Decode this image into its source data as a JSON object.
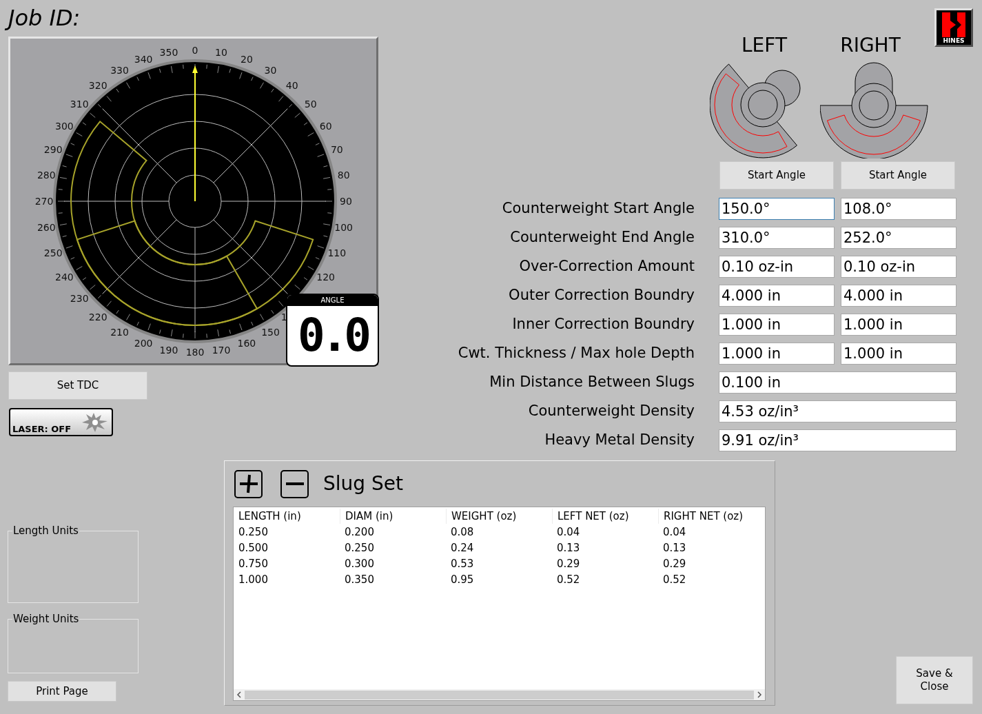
{
  "header": {
    "title": "Job ID:"
  },
  "logo": {
    "text": "HINES"
  },
  "dial": {
    "tick_labels": [
      "350",
      "0",
      "10",
      "340",
      "20",
      "330",
      "30",
      "320",
      "40",
      "310",
      "50",
      "300",
      "60",
      "290",
      "70",
      "280",
      "80",
      "270",
      "90",
      "260",
      "100",
      "250",
      "110",
      "240",
      "120",
      "230",
      "220",
      "1",
      "210",
      "150",
      "200",
      "160",
      "190",
      "180",
      "170"
    ],
    "angle_display": {
      "label": "ANGLE",
      "value": "0.0"
    }
  },
  "left_buttons": {
    "set_tdc": "Set TDC",
    "laser": "LASER: OFF"
  },
  "sides": [
    {
      "heading": "LEFT",
      "button": "Start Angle"
    },
    {
      "heading": "RIGHT",
      "button": "Start Angle"
    }
  ],
  "settings": [
    {
      "label": "Counterweight Start Angle",
      "fields": [
        {
          "value": "150.0°",
          "focused": true
        },
        {
          "value": "108.0°",
          "focused": false
        }
      ]
    },
    {
      "label": "Counterweight End Angle",
      "fields": [
        {
          "value": "310.0°",
          "focused": false
        },
        {
          "value": "252.0°",
          "focused": false
        }
      ]
    },
    {
      "label": "Over-Correction Amount",
      "fields": [
        {
          "value": "0.10 oz-in",
          "focused": false
        },
        {
          "value": "0.10 oz-in",
          "focused": false
        }
      ]
    },
    {
      "label": "Outer Correction Boundry",
      "fields": [
        {
          "value": "4.000 in",
          "focused": false
        },
        {
          "value": "4.000 in",
          "focused": false
        }
      ]
    },
    {
      "label": "Inner Correction Boundry",
      "fields": [
        {
          "value": "1.000 in",
          "focused": false
        },
        {
          "value": "1.000 in",
          "focused": false
        }
      ]
    },
    {
      "label": "Cwt. Thickness / Max hole Depth",
      "fields": [
        {
          "value": "1.000 in",
          "focused": false
        },
        {
          "value": "1.000 in",
          "focused": false
        }
      ]
    },
    {
      "label": "Min Distance Between Slugs",
      "fields": [
        {
          "value": "0.100 in",
          "focused": false
        }
      ]
    },
    {
      "label": "Counterweight Density",
      "fields": [
        {
          "value": "4.53 oz/in³",
          "focused": false
        }
      ]
    },
    {
      "label": "Heavy Metal Density",
      "fields": [
        {
          "value": "9.91 oz/in³",
          "focused": false
        }
      ]
    }
  ],
  "unit_groups": [
    {
      "label": "Length Units"
    },
    {
      "label": "Weight Units"
    }
  ],
  "print_button": "Print Page",
  "slug_set": {
    "title": "Slug Set",
    "columns": [
      "LENGTH (in)",
      "DIAM (in)",
      "WEIGHT (oz)",
      "LEFT NET (oz)",
      "RIGHT NET (oz)"
    ],
    "rows": [
      [
        "0.250",
        "0.200",
        "0.08",
        "0.04",
        "0.04"
      ],
      [
        "0.500",
        "0.250",
        "0.24",
        "0.13",
        "0.13"
      ],
      [
        "0.750",
        "0.300",
        "0.53",
        "0.29",
        "0.29"
      ],
      [
        "1.000",
        "0.350",
        "0.95",
        "0.52",
        "0.52"
      ]
    ]
  },
  "save_button": "Save & Close"
}
